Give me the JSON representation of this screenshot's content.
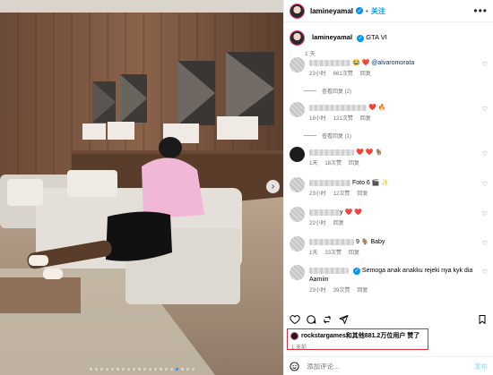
{
  "header": {
    "username": "lamineyamal",
    "separator": "•",
    "follow": "关注",
    "more": "•••"
  },
  "caption": {
    "username": "lamineyamal",
    "text": "GTA VI",
    "time": "1 天"
  },
  "comments": [
    {
      "text_after": "@alvaromorata",
      "emoji": "😂 ❤️",
      "time": "23小时",
      "likes": "661次赞",
      "reply": "回复",
      "replies": "查看回复 (2)"
    },
    {
      "text_after": "",
      "emoji": "❤️ 🔥",
      "time": "18小时",
      "likes": "121次赞",
      "reply": "回复",
      "replies": "查看回复 (1)"
    },
    {
      "text_after": "",
      "emoji": "❤️ ❤️ 🐐",
      "time": "1天",
      "likes": "18次赞",
      "reply": "回复",
      "replies": ""
    },
    {
      "text_after": "Foto 6",
      "emoji": "🎬 ✨",
      "time": "23小时",
      "likes": "12次赞",
      "reply": "回复",
      "replies": ""
    },
    {
      "text_after": "y",
      "emoji": "❤️ ❤️",
      "time": "22小时",
      "likes": "",
      "reply": "回复",
      "replies": ""
    },
    {
      "text_after": "Baby",
      "emoji": "9 🐐",
      "time": "1天",
      "likes": "33次赞",
      "reply": "回复",
      "replies": ""
    },
    {
      "text_after": "Semoga anak anakku rejeki nya kyk dia Aamiin",
      "emoji": "",
      "time": "23小时",
      "likes": "39次赞",
      "reply": "回复",
      "replies": ""
    }
  ],
  "likes": {
    "text": "rockstargames和其他881.2万位用户 赞了",
    "time": "1 天前"
  },
  "composer": {
    "placeholder": "添加评论...",
    "post": "发布"
  },
  "colors": {
    "accent": "#0095f6",
    "highlight": "#e02b3c"
  },
  "icons": [
    "heart-icon",
    "comment-icon",
    "share-icon",
    "send-icon",
    "bookmark-icon",
    "emoji-icon",
    "more-icon",
    "verified-icon",
    "chevron-right-icon"
  ],
  "carousel": {
    "count": 20,
    "active": 16
  }
}
